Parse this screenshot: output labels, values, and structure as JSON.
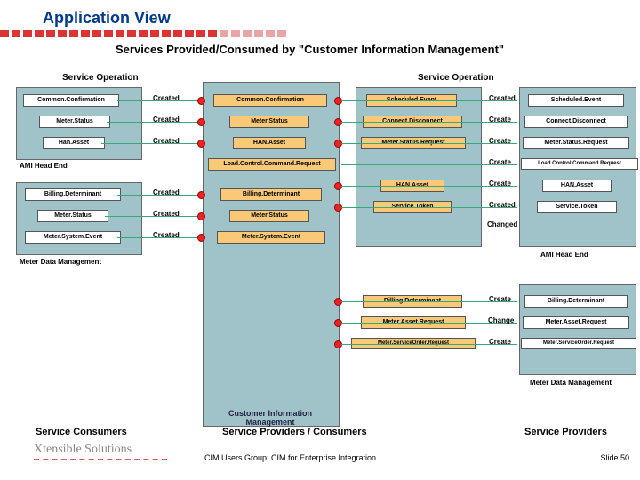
{
  "title": "Application View",
  "subtitle": "Services Provided/Consumed by \"Customer Information Management\"",
  "sectionHeaders": {
    "so1": "Service Operation",
    "so2": "Service Operation"
  },
  "containers": {
    "center": "Customer Information Management",
    "ami": "AMI Head End",
    "mdm": "Meter Data Management",
    "ami2": "AMI Head End",
    "mdm2": "Meter Data Management"
  },
  "leftAmi": [
    {
      "msg": "Common.Confirmation",
      "op": "Created",
      "cMsg": "Common.Confirmation"
    },
    {
      "msg": "Meter.Status",
      "op": "Created",
      "cMsg": "Meter.Status"
    },
    {
      "msg": "Han.Asset",
      "op": "Created",
      "cMsg": "HAN.Asset"
    }
  ],
  "centerExtra": "Load.Control.Command.Request",
  "leftMdm": [
    {
      "msg": "Billing.Determinant",
      "op": "Created",
      "cMsg": "Billing.Determinant"
    },
    {
      "msg": "Meter.Status",
      "op": "Created",
      "cMsg": "Meter.Status"
    },
    {
      "msg": "Meter.System.Event",
      "op": "Created",
      "cMsg": "Meter.System.Event"
    }
  ],
  "rightSched": [
    {
      "msg": "Scheduled.Event",
      "op": "Created",
      "rMsg": "Scheduled.Event"
    },
    {
      "msg": "Connect.Disconnect",
      "op": "Create",
      "rMsg": "Connect.Disconnect"
    },
    {
      "msg": "Meter.Status.Request",
      "op": "Create",
      "rMsg": "Meter.Status.Request"
    },
    {
      "msg": "",
      "op": "Create",
      "rMsg": "Load.Control.Command.Request"
    },
    {
      "msg": "HAN.Asset",
      "op": "Create",
      "rMsg": "HAN.Asset"
    },
    {
      "msg": "Service.Token",
      "op": "Created",
      "rMsg": "Service.Token"
    },
    {
      "msg": "",
      "op": "Changed",
      "rMsg": ""
    }
  ],
  "rightMdm": [
    {
      "msg": "Billing.Determinant",
      "op": "Create",
      "rMsg": "Billing.Determinant"
    },
    {
      "msg": "Meter.Asset.Request",
      "op": "Change",
      "rMsg": "Meter.Asset.Request"
    },
    {
      "msg": "Meter.ServiceOrder.Request",
      "op": "Create",
      "rMsg": "Meter.ServiceOrder.Request"
    }
  ],
  "bottomLabels": {
    "cons": "Service Consumers",
    "pc": "Service Providers / Consumers",
    "prov": "Service Providers"
  },
  "branding": "Xtensible Solutions",
  "footer": "CIM Users Group: CIM for Enterprise Integration",
  "slide": "Slide 50"
}
